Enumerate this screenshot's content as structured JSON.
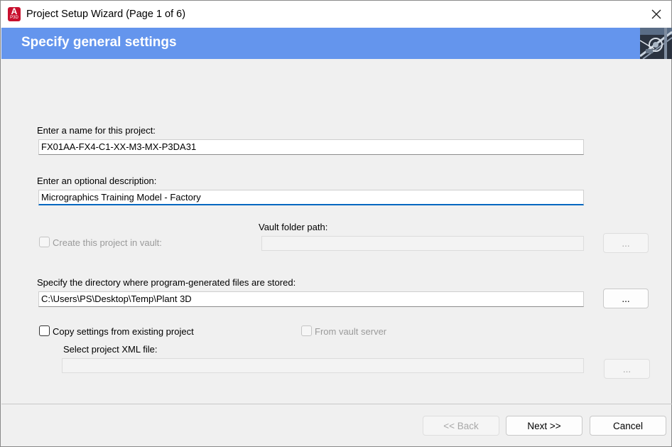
{
  "window": {
    "title": "Project Setup Wizard (Page 1 of 6)",
    "app_icon": {
      "letter": "A",
      "sub": "P3D",
      "color": "#c8102e"
    },
    "close_icon": "close-icon"
  },
  "header": {
    "title": "Specify general settings",
    "band_color": "#6495ed"
  },
  "form": {
    "name_label": "Enter a name for this project:",
    "name_value": "FX01AA-FX4-C1-XX-M3-MX-P3DA31",
    "description_label": "Enter an optional description:",
    "description_value": "Micrographics Training Model - Factory",
    "vault_checkbox_label": "Create this project in vault:",
    "vault_folder_label": "Vault folder path:",
    "vault_folder_value": "",
    "vault_browse_label": "...",
    "directory_label": "Specify the directory where program-generated files are stored:",
    "directory_value": "C:\\Users\\PS\\Desktop\\Temp\\Plant 3D",
    "directory_browse_label": "...",
    "copy_settings_label": "Copy settings from existing project",
    "from_vault_label": "From vault server",
    "xml_label": "Select project XML file:",
    "xml_value": "",
    "xml_browse_label": "..."
  },
  "footer": {
    "back_label": "<< Back",
    "next_label": "Next >>",
    "cancel_label": "Cancel"
  }
}
